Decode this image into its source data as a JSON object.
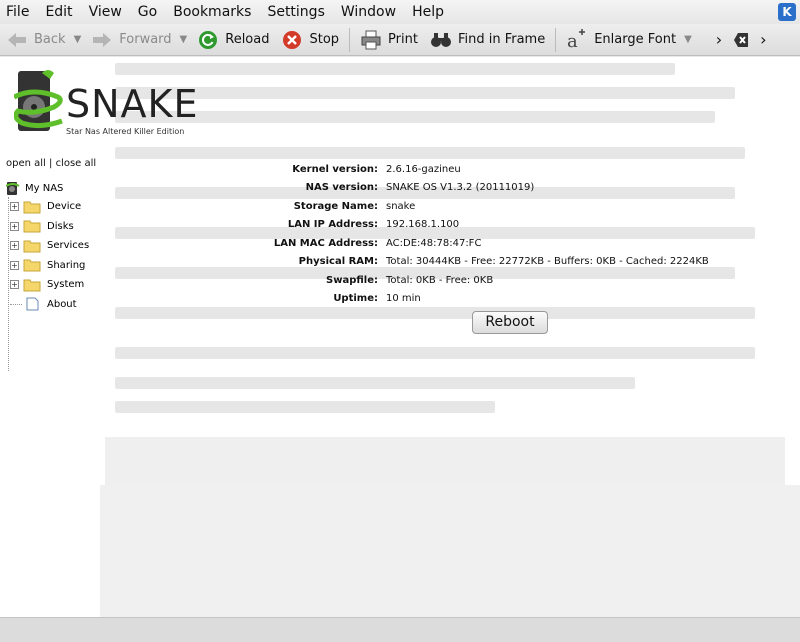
{
  "menu": [
    "File",
    "Edit",
    "View",
    "Go",
    "Bookmarks",
    "Settings",
    "Window",
    "Help"
  ],
  "toolbar": {
    "back": "Back",
    "forward": "Forward",
    "reload": "Reload",
    "stop": "Stop",
    "print": "Print",
    "find_in_frame": "Find in Frame",
    "enlarge_font": "Enlarge Font",
    "more": "›"
  },
  "logo": {
    "title": "SNAKE",
    "subtitle": "Star Nas Altered Killer Edition"
  },
  "tree": {
    "open_all": "open all",
    "separator": " | ",
    "close_all": "close all",
    "root": "My NAS",
    "items": [
      "Device",
      "Disks",
      "Services",
      "Sharing",
      "System",
      "About"
    ]
  },
  "info": [
    {
      "label": "Kernel version:",
      "value": "2.6.16-gazineu"
    },
    {
      "label": "NAS version:",
      "value": "SNAKE OS V1.3.2 (20111019)"
    },
    {
      "label": "Storage Name:",
      "value": "snake"
    },
    {
      "label": "LAN IP Address:",
      "value": "192.168.1.100"
    },
    {
      "label": "LAN MAC Address:",
      "value": "AC:DE:48:78:47:FC"
    },
    {
      "label": "Physical RAM:",
      "value": "Total: 30444KB - Free: 22772KB - Buffers: 0KB - Cached: 2224KB"
    },
    {
      "label": "Swapfile:",
      "value": "Total: 0KB - Free: 0KB"
    },
    {
      "label": "Uptime:",
      "value": "10 min"
    }
  ],
  "reboot_label": "Reboot",
  "colors": {
    "reload": "#2e9a2e",
    "stop": "#d23a2a",
    "logo_green": "#5fbf2a"
  }
}
